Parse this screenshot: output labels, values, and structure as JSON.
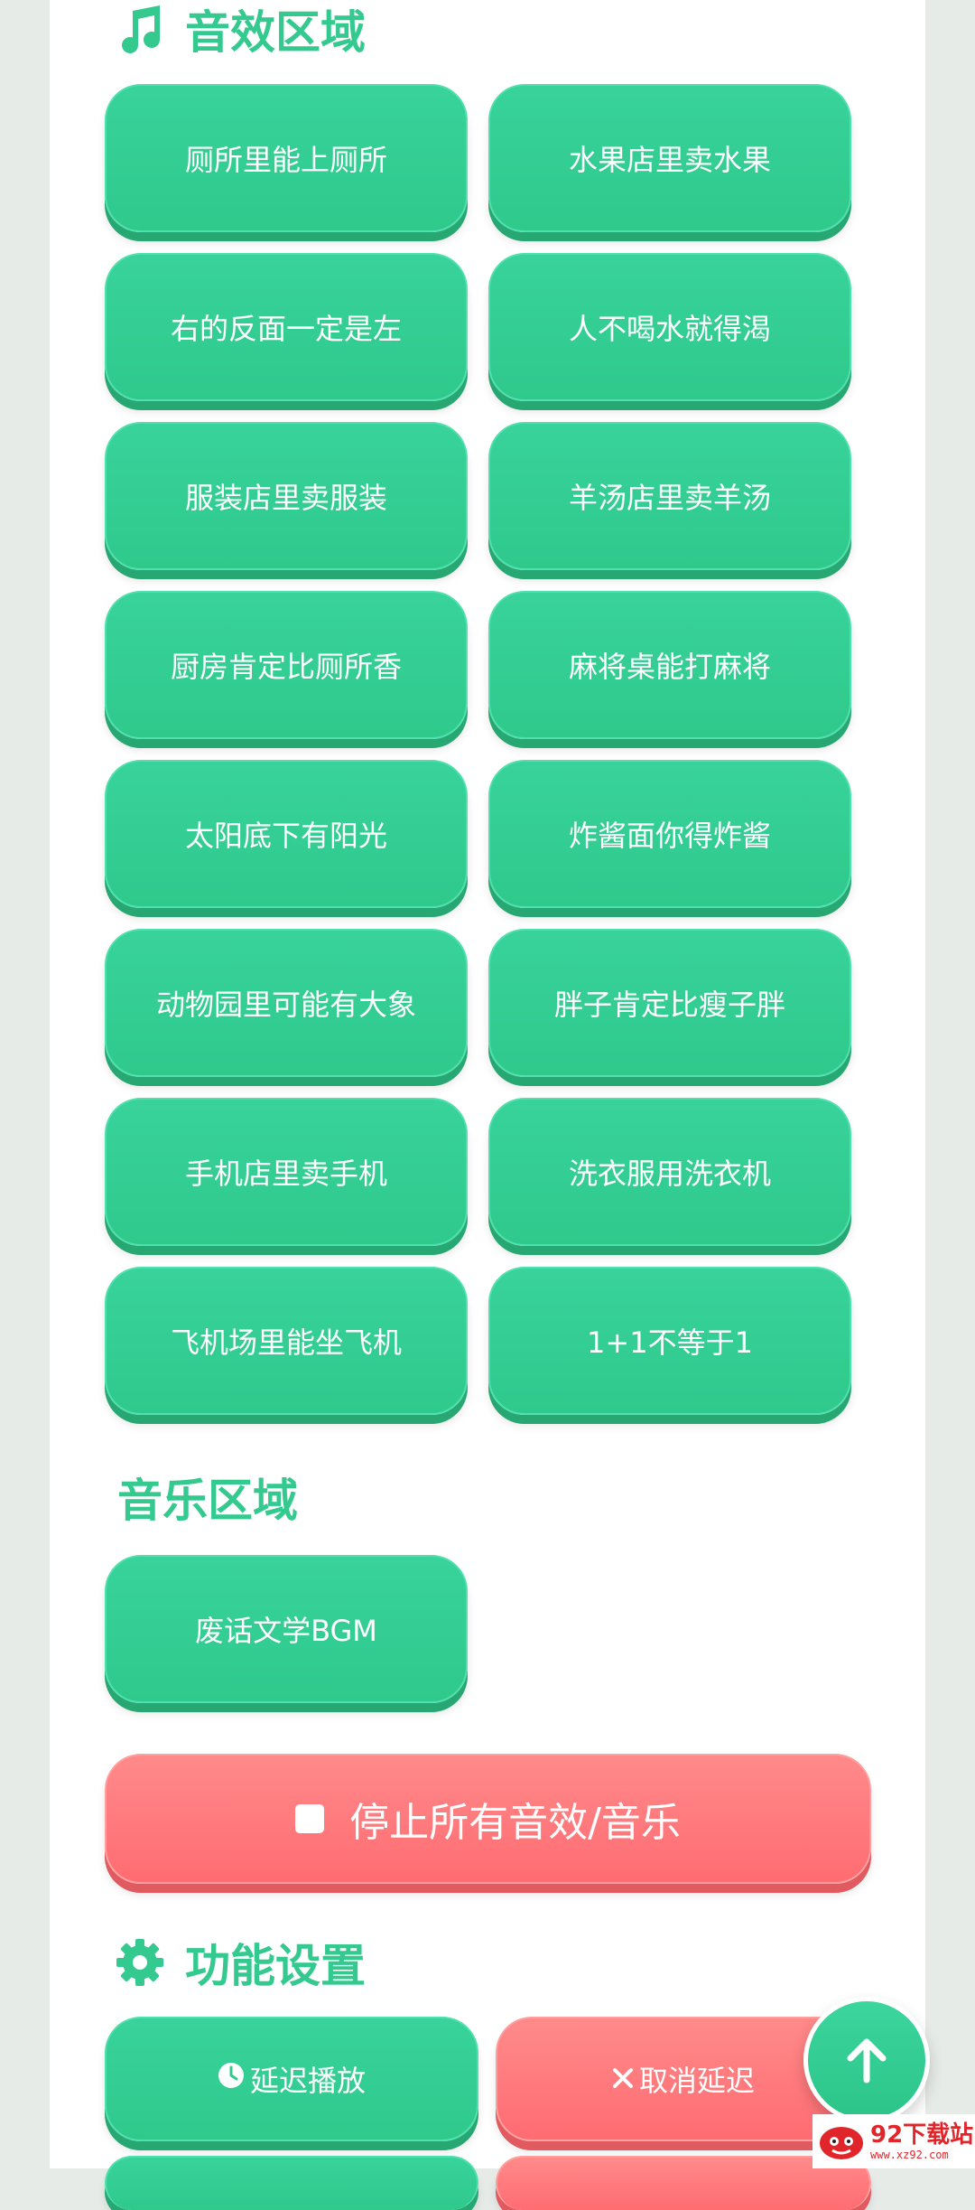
{
  "sections": {
    "sound_title": "音效区域",
    "music_title": "音乐区域",
    "settings_title": "功能设置"
  },
  "sound_buttons": [
    "厕所里能上厕所",
    "水果店里卖水果",
    "右的反面一定是左",
    "人不喝水就得渴",
    "服装店里卖服装",
    "羊汤店里卖羊汤",
    "厨房肯定比厕所香",
    "麻将桌能打麻将",
    "太阳底下有阳光",
    "炸酱面你得炸酱",
    "动物园里可能有大象",
    "胖子肯定比瘦子胖",
    "手机店里卖手机",
    "洗衣服用洗衣机",
    "飞机场里能坐飞机",
    "1+1不等于1"
  ],
  "music_buttons": [
    "废话文学BGM"
  ],
  "controls": {
    "stop_all": "停止所有音效/音乐",
    "delay_play": "延迟播放",
    "cancel_delay": "取消延迟"
  },
  "watermark": {
    "name": "92下载站",
    "url": "www.xz92.com"
  },
  "icons": {
    "sound_section": "music-note-icon",
    "settings_section": "gear-icon",
    "delay": "clock-icon",
    "cancel": "close-icon",
    "fab": "arrow-up-icon",
    "stop": "stop-square-icon"
  },
  "colors": {
    "accent_green": "#34c98f",
    "button_green": "#31cc8d",
    "button_red": "#ff747a",
    "background": "#e6ebe8",
    "watermark_red": "#e0262a"
  }
}
